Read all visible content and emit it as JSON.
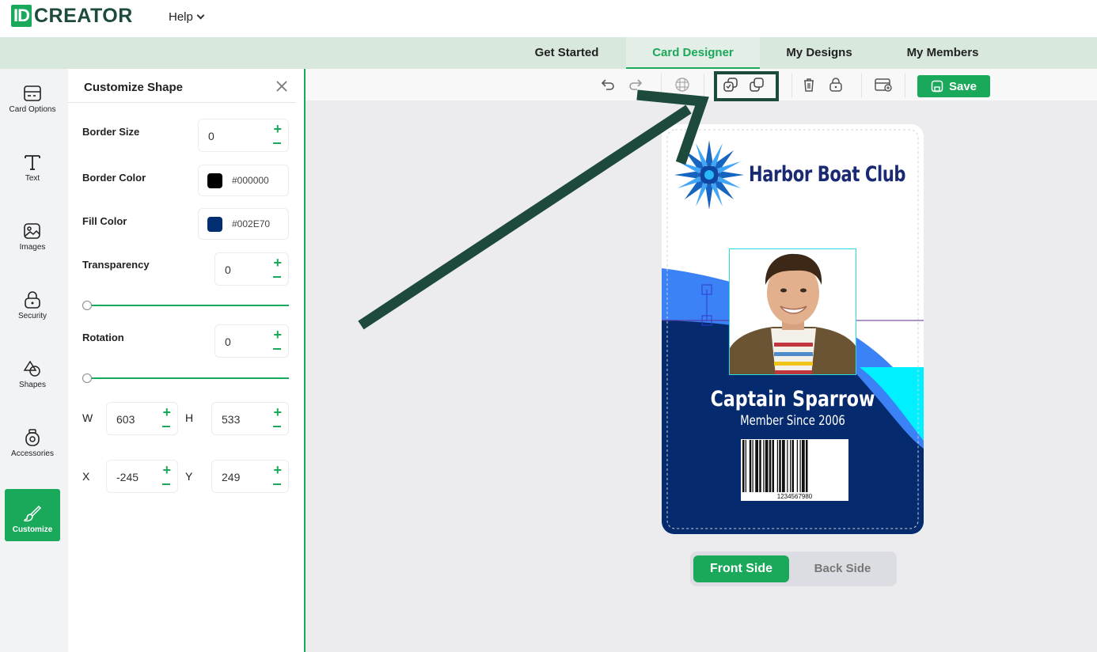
{
  "brand": {
    "id_part": "ID",
    "name_part": "CREATOR"
  },
  "top_menu": {
    "help_label": "Help"
  },
  "nav": {
    "tabs": [
      {
        "label": "Get Started"
      },
      {
        "label": "Card Designer"
      },
      {
        "label": "My Designs"
      },
      {
        "label": "My Members"
      }
    ],
    "active": "Card Designer"
  },
  "sidebar": {
    "items": [
      {
        "label": "Card Options",
        "icon": "card-icon"
      },
      {
        "label": "Text",
        "icon": "text-icon"
      },
      {
        "label": "Images",
        "icon": "image-icon"
      },
      {
        "label": "Security",
        "icon": "lock-icon"
      },
      {
        "label": "Shapes",
        "icon": "shapes-icon"
      },
      {
        "label": "Accessories",
        "icon": "accessories-icon"
      },
      {
        "label": "Customize",
        "icon": "brush-icon"
      }
    ],
    "active": "Customize"
  },
  "panel": {
    "title": "Customize Shape",
    "border_size": {
      "label": "Border Size",
      "value": "0"
    },
    "border_color": {
      "label": "Border Color",
      "value": "#000000",
      "swatch": "#000000"
    },
    "fill_color": {
      "label": "Fill Color",
      "value": "#002E70",
      "swatch": "#002e70"
    },
    "transparency": {
      "label": "Transparency",
      "value": "0"
    },
    "rotation": {
      "label": "Rotation",
      "value": "0"
    },
    "w": {
      "label": "W",
      "value": "603"
    },
    "h": {
      "label": "H",
      "value": "533"
    },
    "x": {
      "label": "X",
      "value": "-245"
    },
    "y": {
      "label": "Y",
      "value": "249"
    }
  },
  "toolbar": {
    "save_label": "Save"
  },
  "card": {
    "club_name": "Harbor Boat Club",
    "member_name": "Captain Sparrow",
    "member_since": "Member Since 2006",
    "barcode_number": "1234567980"
  },
  "side_toggle": {
    "front": "Front Side",
    "back": "Back Side",
    "active": "Front Side"
  },
  "colors": {
    "accent": "#1aa85a",
    "brand_dark": "#1d4a3c",
    "card_navy": "#062a6e",
    "card_blue": "#3b82f6",
    "card_cyan": "#00f0ff"
  }
}
